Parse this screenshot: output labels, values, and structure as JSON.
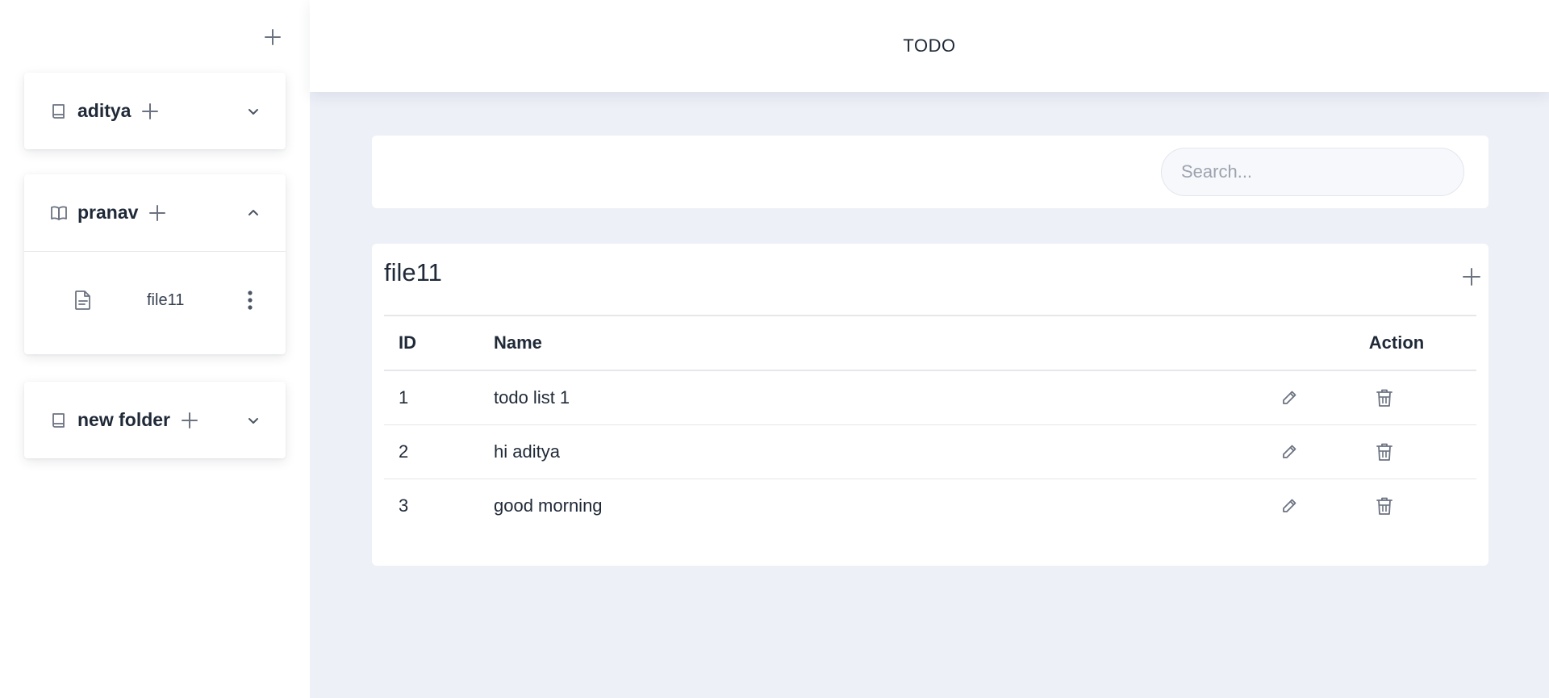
{
  "app": {
    "title": "TODO"
  },
  "sidebar": {
    "add_icon": "plus-icon",
    "folders": [
      {
        "name": "aditya",
        "icon": "book-closed-icon",
        "expanded": false,
        "files": []
      },
      {
        "name": "pranav",
        "icon": "book-open-icon",
        "expanded": true,
        "files": [
          {
            "name": "file11",
            "icon": "document-icon"
          }
        ]
      },
      {
        "name": "new folder",
        "icon": "book-closed-icon",
        "expanded": false,
        "files": []
      }
    ]
  },
  "search": {
    "placeholder": "Search...",
    "value": ""
  },
  "table": {
    "file_title": "file11",
    "headers": {
      "id": "ID",
      "name": "Name",
      "action": "Action"
    },
    "rows": [
      {
        "id": "1",
        "name": "todo list 1"
      },
      {
        "id": "2",
        "name": "hi aditya"
      },
      {
        "id": "3",
        "name": "good morning"
      }
    ]
  },
  "colors": {
    "main_bg": "#edf0f7",
    "card_bg": "#ffffff",
    "text": "#1f2937",
    "icon": "#6b7280"
  }
}
